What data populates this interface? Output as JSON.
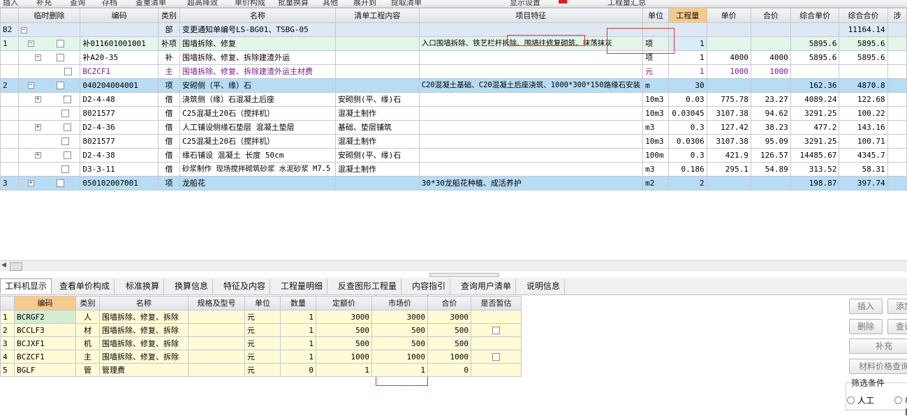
{
  "toolbar": {
    "items": [
      "插入",
      "补充",
      "查询",
      "存档",
      "查重清单",
      "超高降效",
      "单价构成",
      "批量换算",
      "其他",
      "展开到",
      "提取清单",
      "显示设置",
      "工程量汇总"
    ]
  },
  "upper_grid": {
    "headers": {
      "num": "",
      "del": "临时删除",
      "code": "编码",
      "type": "类别",
      "name": "名称",
      "content": "清单工程内容",
      "feature": "项目特征",
      "unit": "单位",
      "qty": "工程量",
      "price": "单价",
      "total": "合价",
      "cprice": "综合单价",
      "ctotal": "综合合价",
      "extra": "涉"
    },
    "rows": [
      {
        "num": "B2",
        "code": "",
        "type": "部",
        "name": "变更通知单编号LS-BG01、TSBG-05",
        "content": "",
        "feature": "",
        "unit": "",
        "qty": "",
        "price": "",
        "total": "",
        "cprice": "",
        "ctotal": "11164.14"
      },
      {
        "num": "1",
        "code": "补011601001001",
        "type": "补项",
        "name": "围墙拆除、修复",
        "content": "",
        "feature": "入口围墙拆除、铁艺栏杆拆除、围墙往修复砌筑、抹荡抹灰",
        "unit": "项",
        "qty": "1",
        "price": "",
        "total": "",
        "cprice": "5895.6",
        "ctotal": "5895.6"
      },
      {
        "num": "",
        "code": "补A20-35",
        "type": "补",
        "name": "围墙拆除、修复、拆除建渣外运",
        "content": "",
        "feature": "",
        "unit": "项",
        "qty": "1",
        "price": "4000",
        "total": "4000",
        "cprice": "5895.6",
        "ctotal": "5895.6"
      },
      {
        "num": "",
        "code": "BCZCF1",
        "type": "主",
        "name": "围墙拆除、修复、拆除建渣外运主材费",
        "content": "",
        "feature": "",
        "unit": "元",
        "qty": "1",
        "price": "1000",
        "total": "1000",
        "cprice": "",
        "ctotal": ""
      },
      {
        "num": "2",
        "code": "040204004001",
        "type": "项",
        "name": "安砌侧（平、缘）石",
        "content": "",
        "feature": "C20混凝土基础、C20混凝土后座浇筑、1000*300*150路缘石安装",
        "unit": "m",
        "qty": "30",
        "price": "",
        "total": "",
        "cprice": "162.36",
        "ctotal": "4870.8"
      },
      {
        "num": "",
        "code": "D2-4-48",
        "type": "借",
        "name": "浇筑侧（缘）石混凝土后座",
        "content": "安砌侧(平、缘)石",
        "feature": "",
        "unit": "10m3",
        "qty": "0.03",
        "price": "775.78",
        "total": "23.27",
        "cprice": "4089.24",
        "ctotal": "122.68"
      },
      {
        "num": "",
        "code": "8021577",
        "type": "借",
        "name": "C25混凝土20石（搅拌机）",
        "content": "混凝土制作",
        "feature": "",
        "unit": "10m3",
        "qty": "0.03045",
        "price": "3107.38",
        "total": "94.62",
        "cprice": "3291.25",
        "ctotal": "100.22"
      },
      {
        "num": "",
        "code": "D2-4-36",
        "type": "借",
        "name": "人工铺设侧缘石垫层 混凝土垫层",
        "content": "基础、垫层铺筑",
        "feature": "",
        "unit": "m3",
        "qty": "0.3",
        "price": "127.42",
        "total": "38.23",
        "cprice": "477.2",
        "ctotal": "143.16"
      },
      {
        "num": "",
        "code": "8021577",
        "type": "借",
        "name": "C25混凝土20石（搅拌机）",
        "content": "混凝土制作",
        "feature": "",
        "unit": "10m3",
        "qty": "0.0306",
        "price": "3107.38",
        "total": "95.09",
        "cprice": "3291.25",
        "ctotal": "100.71"
      },
      {
        "num": "",
        "code": "D2-4-38",
        "type": "借",
        "name": "缘石铺设 混凝土 长度 50cm",
        "content": "安砌侧(平、缘)石",
        "feature": "",
        "unit": "100m",
        "qty": "0.3",
        "price": "421.9",
        "total": "126.57",
        "cprice": "14485.67",
        "ctotal": "4345.7"
      },
      {
        "num": "",
        "code": "D3-3-11",
        "type": "借",
        "name": "砂浆制作 现场搅拌砌筑砂浆 水泥砂浆 M7.5",
        "content": "混凝土制作",
        "feature": "",
        "unit": "m3",
        "qty": "0.186",
        "price": "295.1",
        "total": "54.89",
        "cprice": "313.52",
        "ctotal": "58.31"
      },
      {
        "num": "3",
        "code": "050102007001",
        "type": "项",
        "name": "龙船花",
        "content": "",
        "feature": "30*30龙船花种植、成活养护",
        "unit": "m2",
        "qty": "2",
        "price": "",
        "total": "",
        "cprice": "198.87",
        "ctotal": "397.74"
      }
    ]
  },
  "tabs": [
    "工料机显示",
    "查看单价构成",
    "标准换算",
    "换算信息",
    "特征及内容",
    "工程量明细",
    "反查图形工程量",
    "内容指引",
    "查询用户清单",
    "说明信息"
  ],
  "lower_grid": {
    "headers": {
      "num": "",
      "code": "编码",
      "type": "类别",
      "name": "名称",
      "spec": "规格及型号",
      "unit": "单位",
      "qty": "数量",
      "quota": "定额价",
      "market": "市场价",
      "total": "合价",
      "temp": "是否暂估"
    },
    "rows": [
      {
        "num": "1",
        "code": "BCRGF2",
        "type": "人",
        "name": "围墙拆除、修复、拆除",
        "spec": "",
        "unit": "元",
        "qty": "1",
        "quota": "3000",
        "market": "3000",
        "total": "3000",
        "temp": false
      },
      {
        "num": "2",
        "code": "BCCLF3",
        "type": "材",
        "name": "围墙拆除、修复、拆除",
        "spec": "",
        "unit": "元",
        "qty": "1",
        "quota": "500",
        "market": "500",
        "total": "500",
        "temp": true
      },
      {
        "num": "3",
        "code": "BCJXF1",
        "type": "机",
        "name": "围墙拆除、修复、拆除",
        "spec": "",
        "unit": "元",
        "qty": "1",
        "quota": "500",
        "market": "500",
        "total": "500",
        "temp": false
      },
      {
        "num": "4",
        "code": "BCZCF1",
        "type": "主",
        "name": "围墙拆除、修复、拆除",
        "spec": "",
        "unit": "元",
        "qty": "1",
        "quota": "1000",
        "market": "1000",
        "total": "1000",
        "temp": true
      },
      {
        "num": "5",
        "code": "BGLF",
        "type": "管",
        "name": "管理费",
        "spec": "",
        "unit": "元",
        "qty": "0",
        "quota": "1",
        "market": "1",
        "total": "0",
        "temp": false
      }
    ]
  },
  "right_panel": {
    "insert": "插入",
    "add": "添加",
    "delete": "删除",
    "query": "查询",
    "supplement": "补充",
    "price_query": "材料价格查询",
    "filter_label": "筛选条件",
    "radio_labor": "人工",
    "radio_material": "材料"
  },
  "colors": {
    "selected_row": "#b7dcf3",
    "item_row": "#e4f5e9",
    "header_highlight": "#f6c98c",
    "annotation_box": "#e03030",
    "lower_bg": "#fffbd6"
  }
}
